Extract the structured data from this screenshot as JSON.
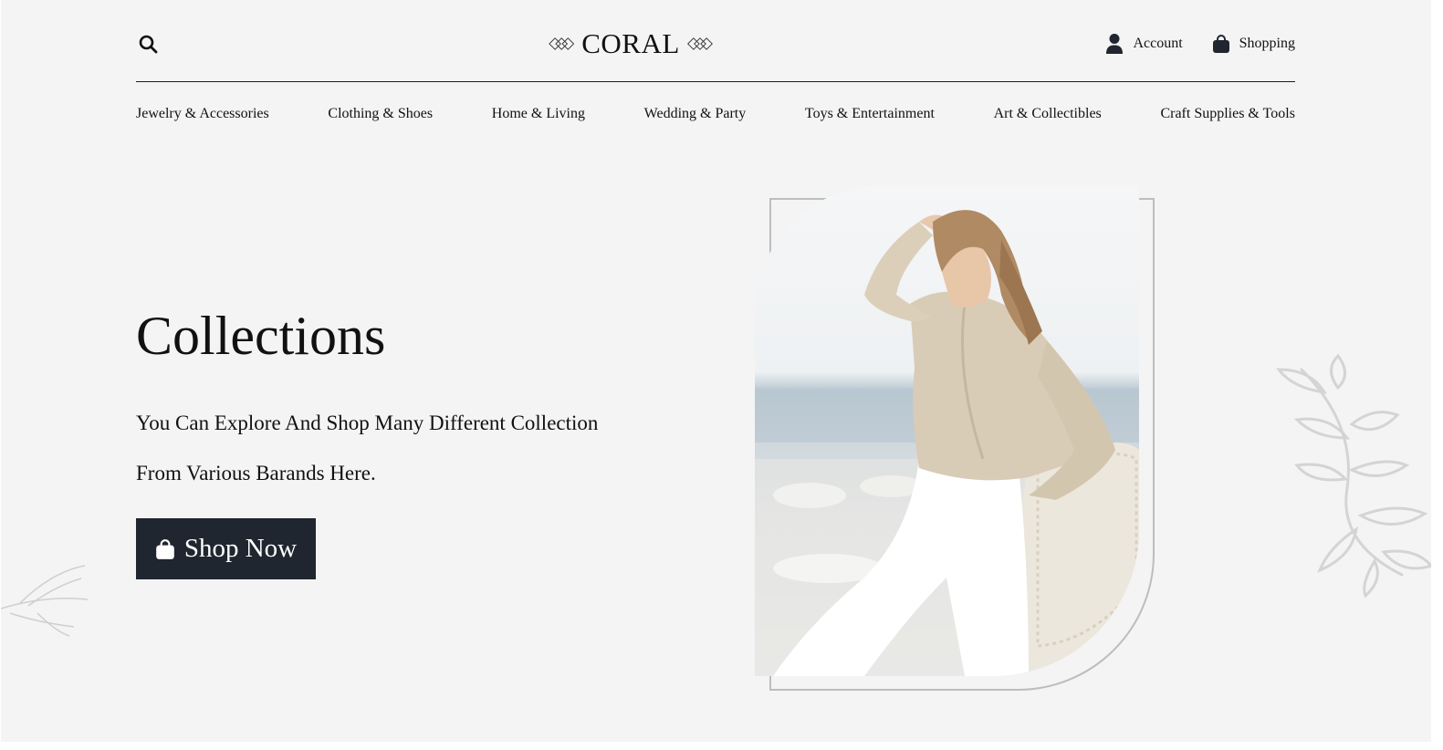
{
  "header": {
    "logo_text": "CORAL",
    "account_label": "Account",
    "shopping_label": "Shopping",
    "icons": [
      "search-icon",
      "user-icon",
      "shopping-bag-icon",
      "logo-ornament-icon"
    ]
  },
  "nav": {
    "items": [
      {
        "label": "Jewelry & Accessories"
      },
      {
        "label": "Clothing & Shoes"
      },
      {
        "label": "Home & Living"
      },
      {
        "label": "Wedding & Party"
      },
      {
        "label": "Toys & Entertainment"
      },
      {
        "label": "Art & Collectibles"
      },
      {
        "label": "Craft Supplies & Tools"
      }
    ]
  },
  "hero": {
    "title": "Collections",
    "description_line1": "You Can Explore And Shop Many Different Collection",
    "description_line2": "From Various Barands Here.",
    "button_label": "Shop Now"
  },
  "colors": {
    "background": "#f4f4f4",
    "button": "#1f2630",
    "text": "#111111",
    "frame": "#bdbdbd"
  }
}
